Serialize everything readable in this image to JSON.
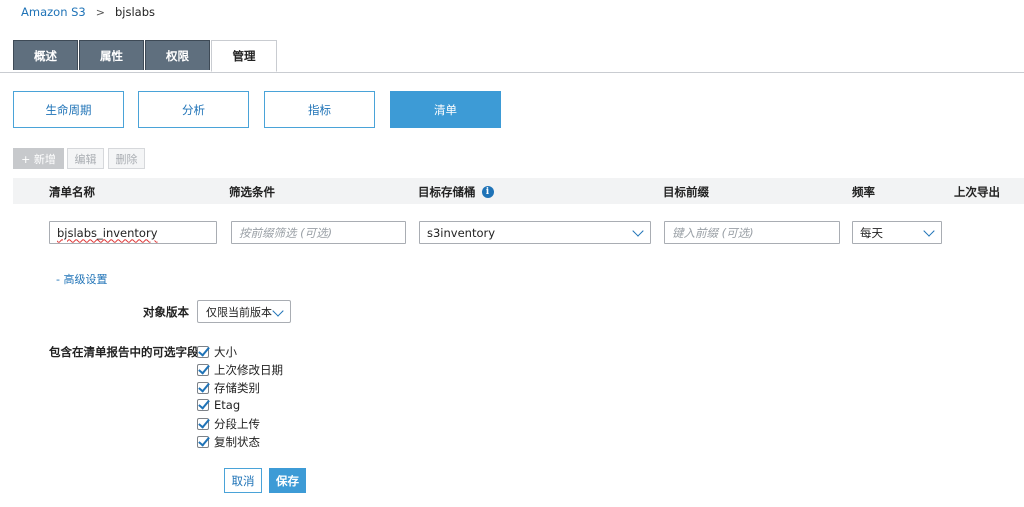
{
  "breadcrumb": {
    "root": "Amazon S3",
    "separator": ">",
    "current": "bjslabs"
  },
  "tabs": [
    {
      "label": "概述"
    },
    {
      "label": "属性"
    },
    {
      "label": "权限"
    },
    {
      "label": "管理"
    }
  ],
  "subnav": [
    {
      "label": "生命周期"
    },
    {
      "label": "分析"
    },
    {
      "label": "指标"
    },
    {
      "label": "清单"
    }
  ],
  "actions": {
    "add": "+ 新增",
    "edit": "编辑",
    "delete": "删除"
  },
  "table": {
    "headers": {
      "name": "清单名称",
      "filter": "筛选条件",
      "target_bucket": "目标存储桶",
      "target_prefix": "目标前缀",
      "frequency": "频率",
      "last_export": "上次导出"
    },
    "row": {
      "name_value": "bjslabs_inventory",
      "filter_placeholder": "按前缀筛选 (可选)",
      "target_bucket_value": "s3inventory",
      "prefix_placeholder": "键入前缀 (可选)",
      "frequency_value": "每天"
    }
  },
  "advanced": {
    "label": "- 高级设置"
  },
  "object_version": {
    "label": "对象版本",
    "value": "仅限当前版本"
  },
  "optional_fields": {
    "label": "包含在清单报告中的可选字段",
    "items": [
      "大小",
      "上次修改日期",
      "存储类别",
      "Etag",
      "分段上传",
      "复制状态"
    ]
  },
  "footer": {
    "cancel": "取消",
    "save": "保存"
  },
  "colors": {
    "accent": "#3d9bd6",
    "link": "#1f73b7",
    "tab_dark": "#5f6f7e"
  }
}
